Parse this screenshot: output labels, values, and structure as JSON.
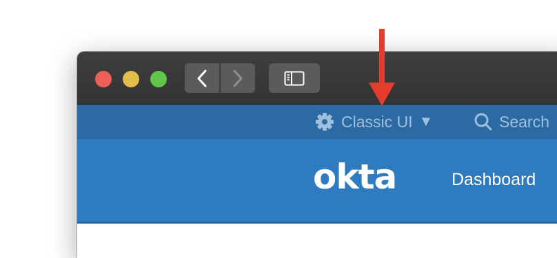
{
  "window": {
    "controls": [
      "close",
      "minimize",
      "zoom"
    ],
    "nav_icons": [
      "chevron-left-icon",
      "chevron-right-icon",
      "sidebar-icon"
    ]
  },
  "topbar": {
    "settings_label": "Classic UI",
    "settings_caret": "▼",
    "search_label": "Search"
  },
  "header": {
    "logo_text": "okta",
    "nav_dashboard": "Dashboard"
  },
  "colors": {
    "topbar_bg": "#2c6aa3",
    "header_bg": "#2f7bc0",
    "annotation_arrow": "#e53b2a"
  }
}
